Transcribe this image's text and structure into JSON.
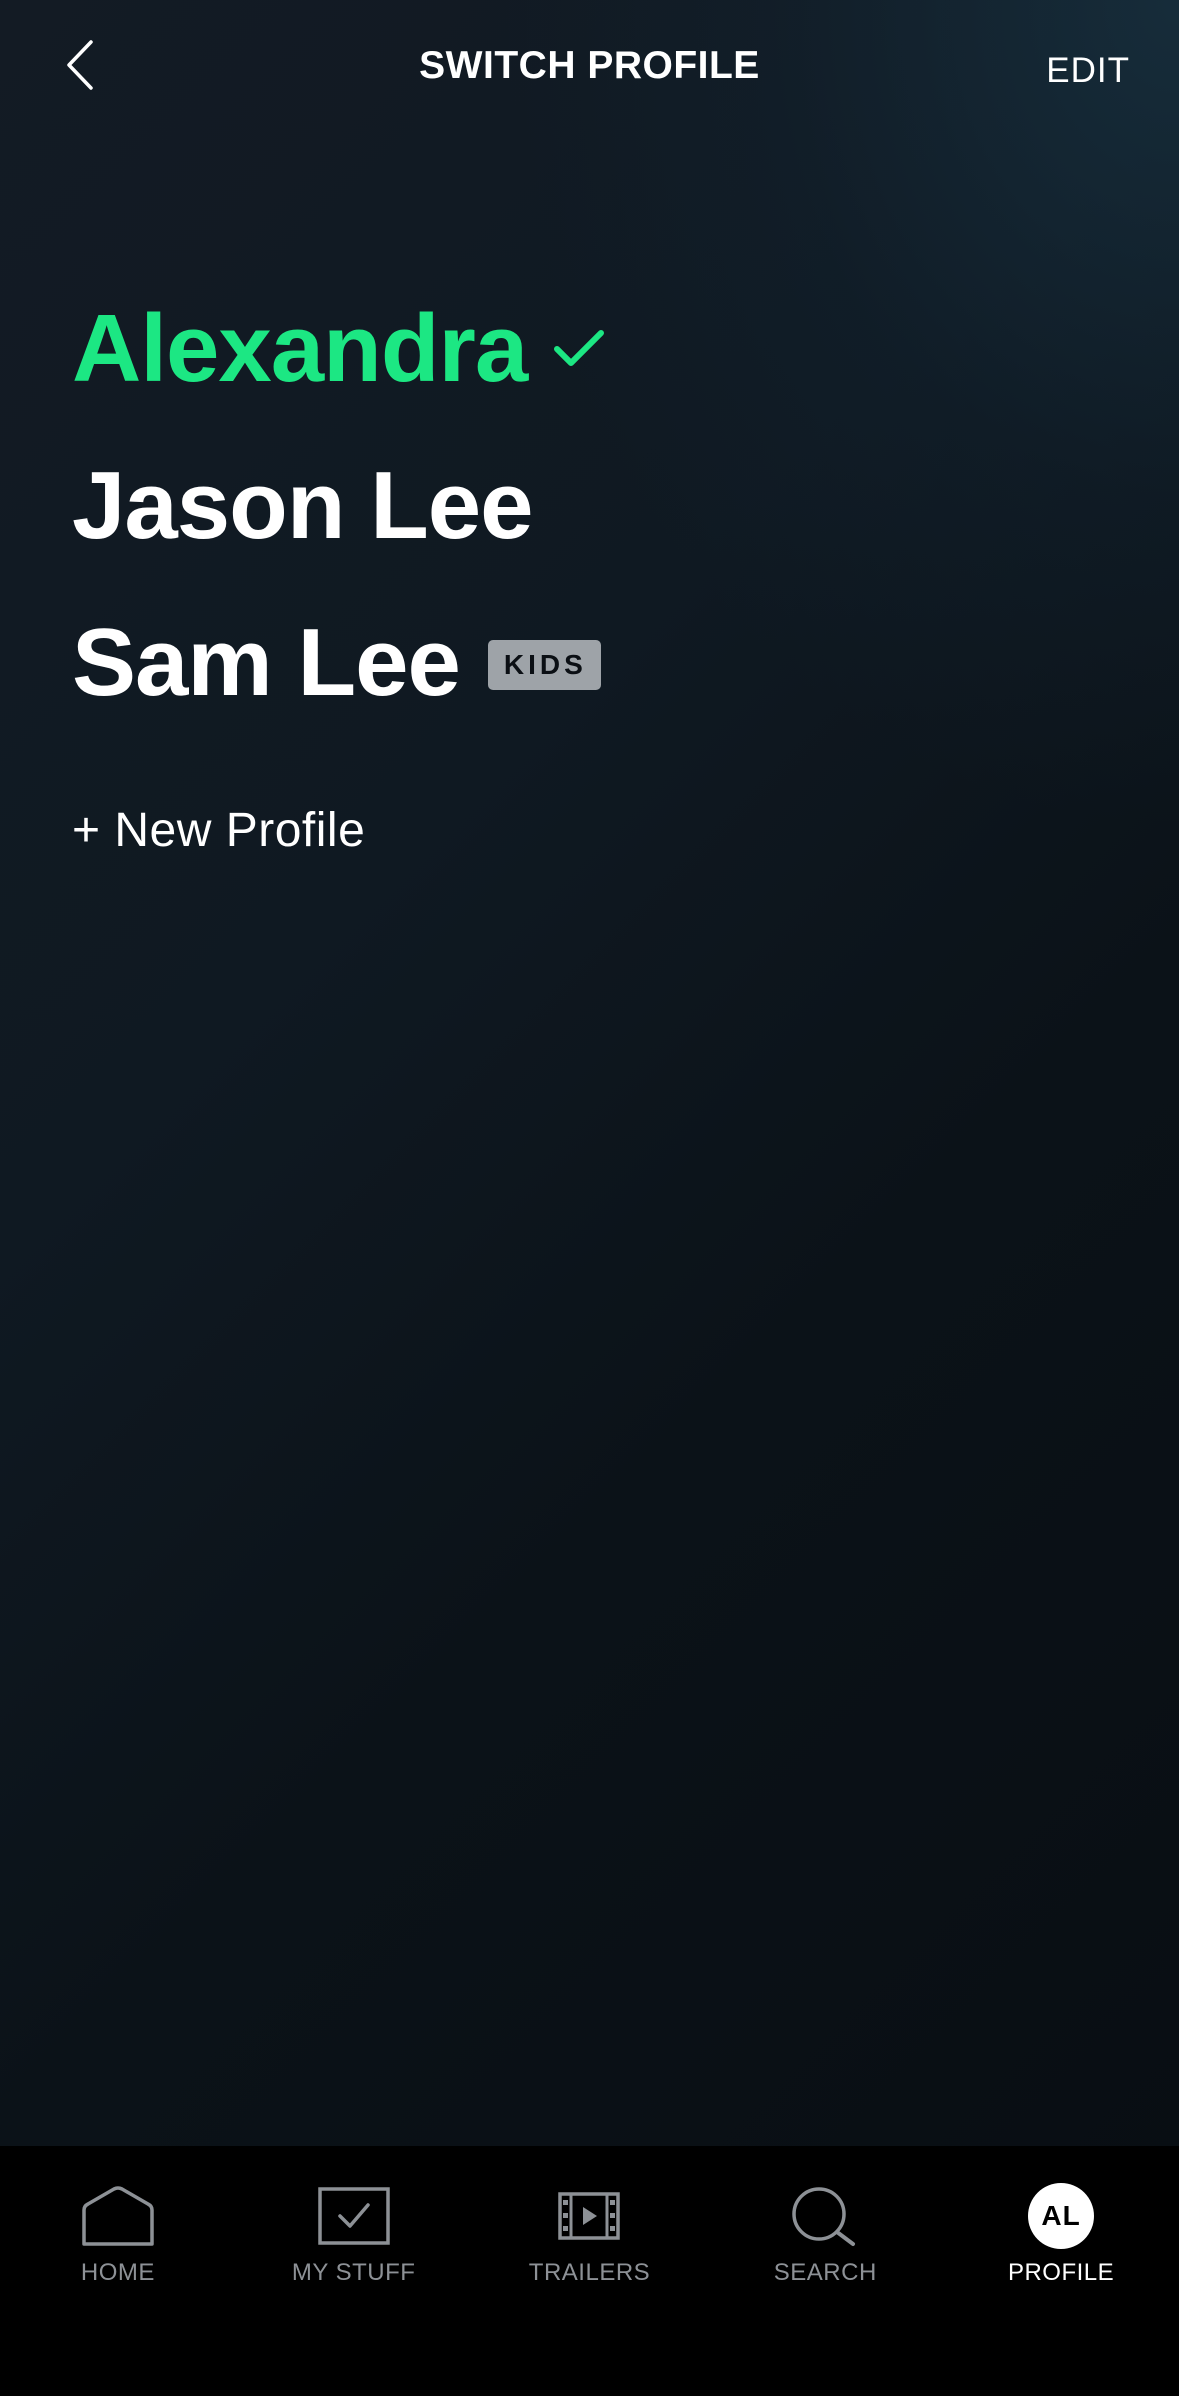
{
  "header": {
    "title": "SWITCH PROFILE",
    "edit_label": "EDIT",
    "back_icon": "chevron-left-icon"
  },
  "profiles": [
    {
      "name": "Alexandra",
      "active": true,
      "badge": ""
    },
    {
      "name": "Jason Lee",
      "active": false,
      "badge": ""
    },
    {
      "name": "Sam Lee",
      "active": false,
      "badge": "KIDS"
    }
  ],
  "new_profile_label": "+ New Profile",
  "nav": {
    "items": [
      {
        "label": "HOME",
        "icon": "home-icon"
      },
      {
        "label": "MY STUFF",
        "icon": "my-stuff-icon"
      },
      {
        "label": "TRAILERS",
        "icon": "film-icon"
      },
      {
        "label": "SEARCH",
        "icon": "search-icon"
      },
      {
        "label": "PROFILE",
        "icon": "avatar-icon",
        "avatar_initials": "AL",
        "active": true
      }
    ]
  },
  "colors": {
    "accent": "#1ce783",
    "badge_bg": "#9ea3a8",
    "nav_inactive": "#8d9196"
  }
}
